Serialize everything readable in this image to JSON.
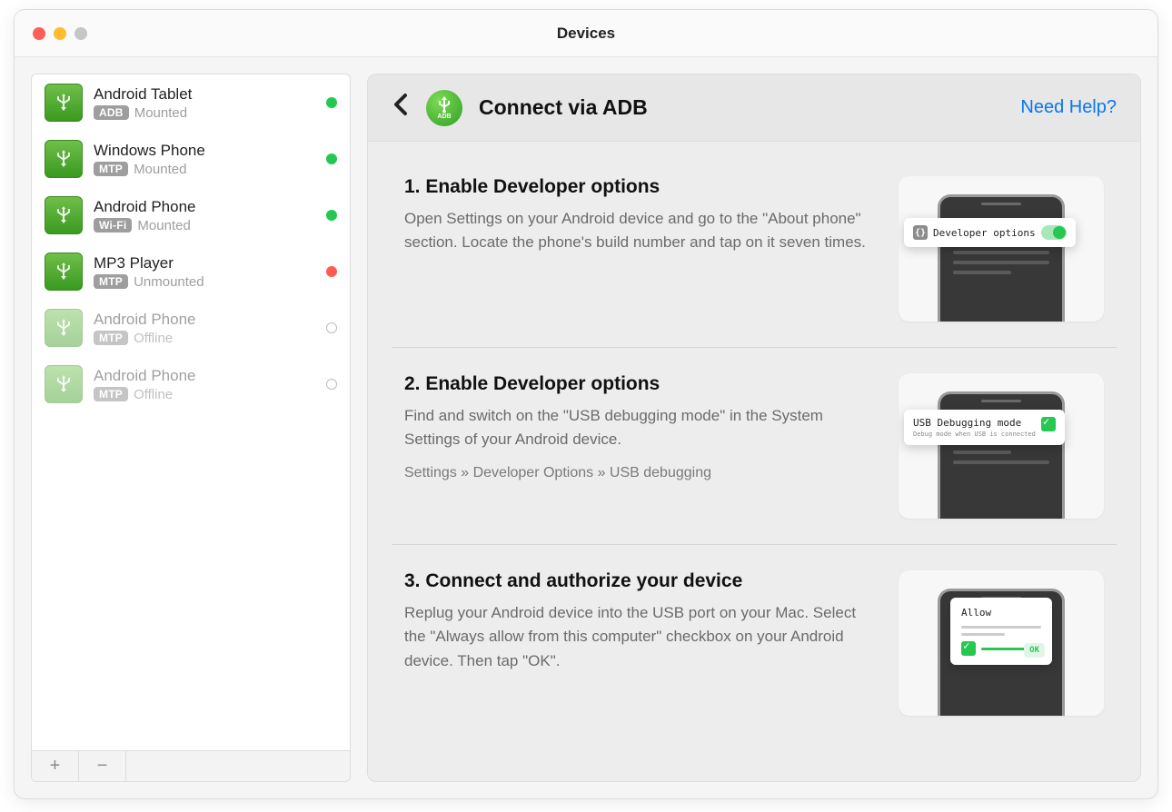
{
  "window": {
    "title": "Devices"
  },
  "sidebar": {
    "devices": [
      {
        "name": "Android Tablet",
        "badge": "ADB",
        "status": "Mounted",
        "dot": "green",
        "dim": false
      },
      {
        "name": "Windows Phone",
        "badge": "MTP",
        "status": "Mounted",
        "dot": "green",
        "dim": false
      },
      {
        "name": "Android Phone",
        "badge": "Wi-Fi",
        "status": "Mounted",
        "dot": "green",
        "dim": false
      },
      {
        "name": "MP3 Player",
        "badge": "MTP",
        "status": "Unmounted",
        "dot": "red",
        "dim": false
      },
      {
        "name": "Android Phone",
        "badge": "MTP",
        "status": "Offline",
        "dot": "outline",
        "dim": true
      },
      {
        "name": "Android Phone",
        "badge": "MTP",
        "status": "Offline",
        "dot": "outline",
        "dim": true
      }
    ],
    "add_label": "+",
    "remove_label": "−"
  },
  "header": {
    "title": "Connect via ADB",
    "adb_label": "ADB",
    "help_link": "Need Help?"
  },
  "steps": [
    {
      "title": "1. Enable Developer options",
      "desc": "Open Settings on your Android device and go to the \"About phone\" section. Locate the phone's build number and tap on it seven times.",
      "overlay": {
        "type": "toggle",
        "label": "Developer options"
      }
    },
    {
      "title": "2. Enable Developer options",
      "desc": "Find and switch on the \"USB debugging mode\" in the System Settings of your Android device.",
      "path": "Settings » Developer Options » USB debugging",
      "overlay": {
        "type": "checkbox",
        "label": "USB Debugging mode",
        "sub": "Debug mode when USB is connected"
      }
    },
    {
      "title": "3. Connect and authorize your device",
      "desc": "Replug your Android device into the USB port on your Mac. Select the \"Always allow from this computer\" checkbox on your Android device. Then tap \"OK\".",
      "overlay": {
        "type": "dialog",
        "label": "Allow",
        "ok": "OK"
      }
    }
  ],
  "visual": {
    "allow_hint": "Allow"
  }
}
